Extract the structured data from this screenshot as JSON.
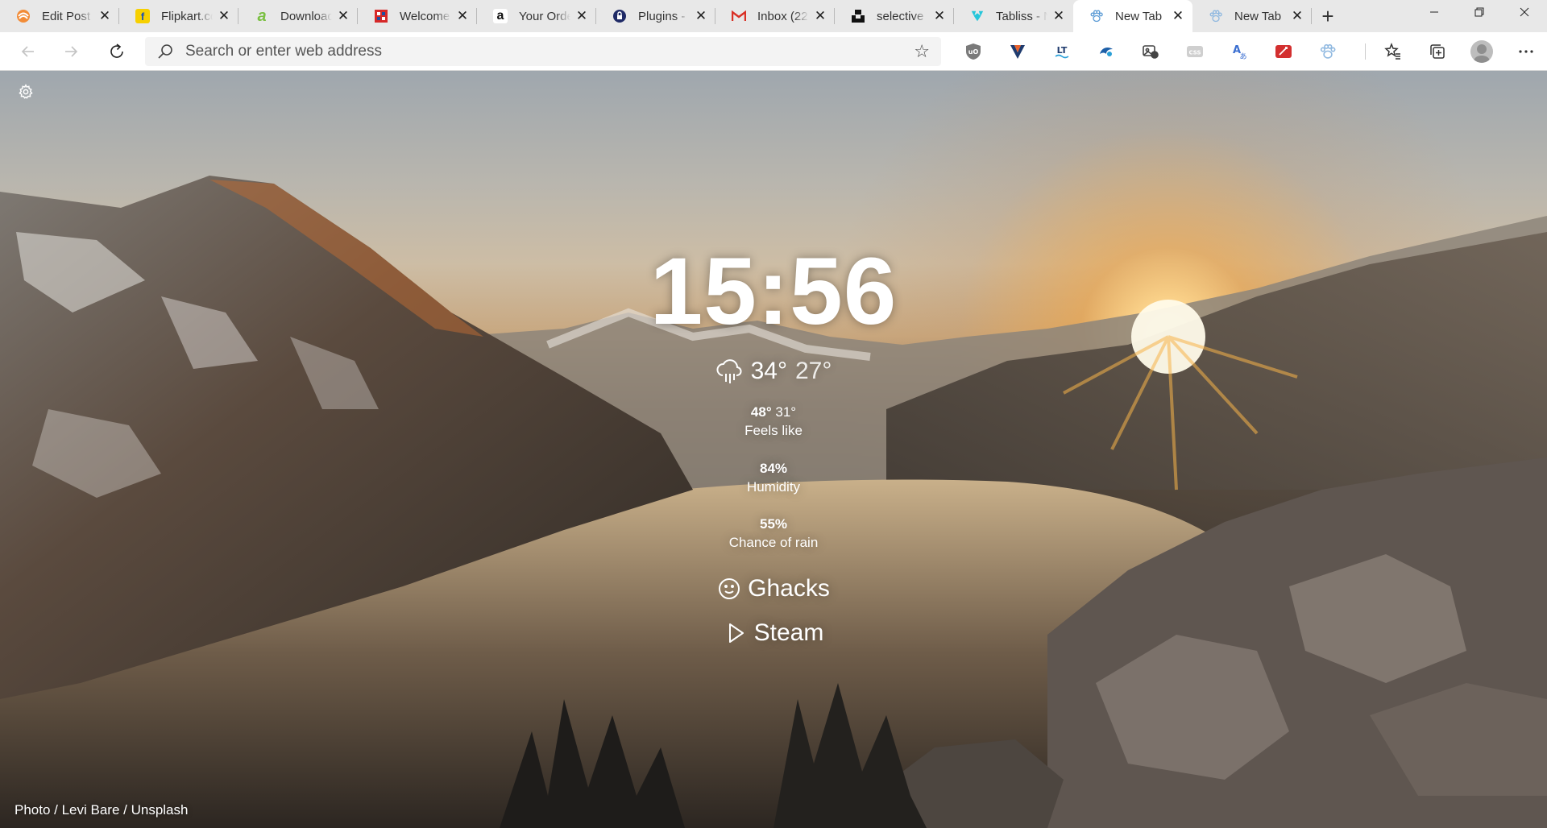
{
  "tabs": [
    {
      "title": "Edit Post",
      "favicon_color": "#e86c2c",
      "favicon": "swirl-icon"
    },
    {
      "title": "Flipkart.com",
      "favicon_color": "#f7d000",
      "favicon": "flipkart-icon"
    },
    {
      "title": "Download",
      "favicon_color": "#7bc043",
      "favicon": "a-letter-icon"
    },
    {
      "title": "Welcome",
      "favicon_color": "#d62828",
      "favicon": "grid-logo-icon"
    },
    {
      "title": "Your Orders",
      "favicon_color": "#111111",
      "favicon": "amazon-icon"
    },
    {
      "title": "Plugins - ",
      "favicon_color": "#1f2a66",
      "favicon": "lock-circle-icon"
    },
    {
      "title": "Inbox (22",
      "favicon_color": "#d93025",
      "favicon": "gmail-icon"
    },
    {
      "title": "selective ",
      "favicon_color": "#111111",
      "favicon": "unsplash-icon"
    },
    {
      "title": "Tabliss - N",
      "favicon_color": "#26c6da",
      "favicon": "tabliss-icon"
    },
    {
      "title": "New Tab",
      "favicon_color": "#5b9bd5",
      "favicon": "paw-icon",
      "active": true
    },
    {
      "title": "New Tab",
      "favicon_color": "#5b9bd5",
      "favicon": "paw-icon"
    }
  ],
  "toolbar": {
    "address_placeholder": "Search or enter web address"
  },
  "extensions": [
    {
      "name": "ublock-icon",
      "color": "#7a7a7a",
      "glyph": "u"
    },
    {
      "name": "vivaldi-v-icon",
      "color": "#c24a1c",
      "glyph": "V"
    },
    {
      "name": "languagetool-icon",
      "color": "#1f3b6e",
      "glyph": "LT"
    },
    {
      "name": "wave-icon",
      "color": "#1d5fa8",
      "glyph": "~"
    },
    {
      "name": "image-tool-icon",
      "color": "#444444",
      "glyph": "▣"
    },
    {
      "name": "css-icon",
      "color": "#bdbdbd",
      "glyph": "css"
    },
    {
      "name": "translate-icon",
      "color": "#3b6fd1",
      "glyph": "A"
    },
    {
      "name": "pdf-icon",
      "color": "#d32f2f",
      "glyph": "✎"
    },
    {
      "name": "paw-icon",
      "color": "#8fb8e0",
      "glyph": "❀"
    }
  ],
  "page": {
    "time": "15:56",
    "weather": {
      "high": "34°",
      "low": "27°",
      "feels_like_high": "48°",
      "feels_like_low": "31°",
      "feels_like_label": "Feels like",
      "humidity": "84%",
      "humidity_label": "Humidity",
      "rain_chance": "55%",
      "rain_chance_label": "Chance of rain"
    },
    "links": [
      {
        "label": "Ghacks",
        "icon": "smile-icon"
      },
      {
        "label": "Steam",
        "icon": "play-icon"
      }
    ],
    "credit": "Photo / Levi Bare / Unsplash"
  }
}
